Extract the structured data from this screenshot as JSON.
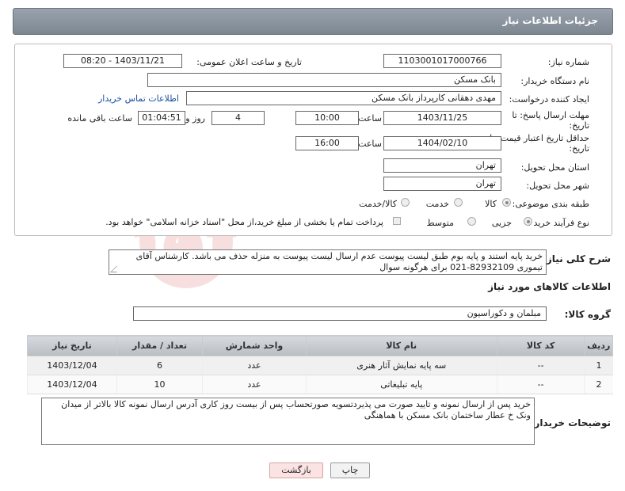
{
  "header": {
    "title": "جزئیات اطلاعات نیاز"
  },
  "form": {
    "need_number_label": "شماره نیاز:",
    "need_number": "1103001017000766",
    "announce_label": "تاریخ و ساعت اعلان عمومی:",
    "announce_value": "1403/11/21 - 08:20",
    "buyer_label": "نام دستگاه خریدار:",
    "buyer_value": "بانک مسکن",
    "creator_label": "ایجاد کننده درخواست:",
    "creator_value": "مهدی دهقانی کارپرداز بانک مسکن",
    "contact_link": "اطلاعات تماس خریدار",
    "deadline_label_1": "مهلت ارسال پاسخ: تا",
    "deadline_label_2": "تاریخ:",
    "deadline_date": "1403/11/25",
    "time_label": "ساعت",
    "deadline_time": "10:00",
    "days_value": "4",
    "days_label": "روز و",
    "remaining_time": "01:04:51",
    "remaining_label": "ساعت باقی مانده",
    "validity_label_1": "حداقل تاریخ اعتبار قیمت: تا",
    "validity_label_2": "تاریخ:",
    "validity_date": "1404/02/10",
    "validity_time": "16:00",
    "province_label": "استان محل تحویل:",
    "province_value": "تهران",
    "city_label": "شهر محل تحویل:",
    "city_value": "تهران",
    "category_label": "طبقه بندی موضوعی:",
    "category_options": [
      "کالا",
      "خدمت",
      "کالا/خدمت"
    ],
    "process_label": "نوع فرآیند خرید :",
    "process_options": [
      "جزیی",
      "متوسط"
    ],
    "payment_text": "پرداخت تمام یا بخشی از مبلغ خرید،از محل \"اسناد خزانه اسلامی\" خواهد بود."
  },
  "description": {
    "label": "شرح کلی نیاز:",
    "text": "خرید پایه استند و پایه بوم طبق لیست پیوست عدم ارسال لیست پیوست به منزله حذف می باشد. کارشناس آقای تیموری 82932109-021 برای هرگونه سوال"
  },
  "goods": {
    "section_title": "اطلاعات کالاهای مورد نیاز",
    "group_label": "گروه کالا:",
    "group_value": "مبلمان و دکوراسیون",
    "columns": [
      "ردیف",
      "کد کالا",
      "نام کالا",
      "واحد شمارش",
      "تعداد / مقدار",
      "تاریخ نیاز"
    ],
    "rows": [
      {
        "row": "1",
        "code": "--",
        "name": "سه پایه نمایش آثار هنری",
        "unit": "عدد",
        "qty": "6",
        "date": "1403/12/04"
      },
      {
        "row": "2",
        "code": "--",
        "name": "پایه تبلیغاتی",
        "unit": "عدد",
        "qty": "10",
        "date": "1403/12/04"
      }
    ]
  },
  "buyer_notes": {
    "label": "توضیحات خریدار:",
    "text": "خرید پس از ارسال نمونه و تایید صورت می پذیردتسویه صورتحساب پس از بیست روز کاری آدرس ارسال نمونه کالا بالاتر از میدان ونک خ عطار ساختمان بانک مسکن با هماهنگی"
  },
  "buttons": {
    "print": "چاپ",
    "back": "بازگشت"
  },
  "colors": {
    "header": "#8a939c",
    "link": "#1a4fa0",
    "back_button": "#fbe3e3"
  }
}
